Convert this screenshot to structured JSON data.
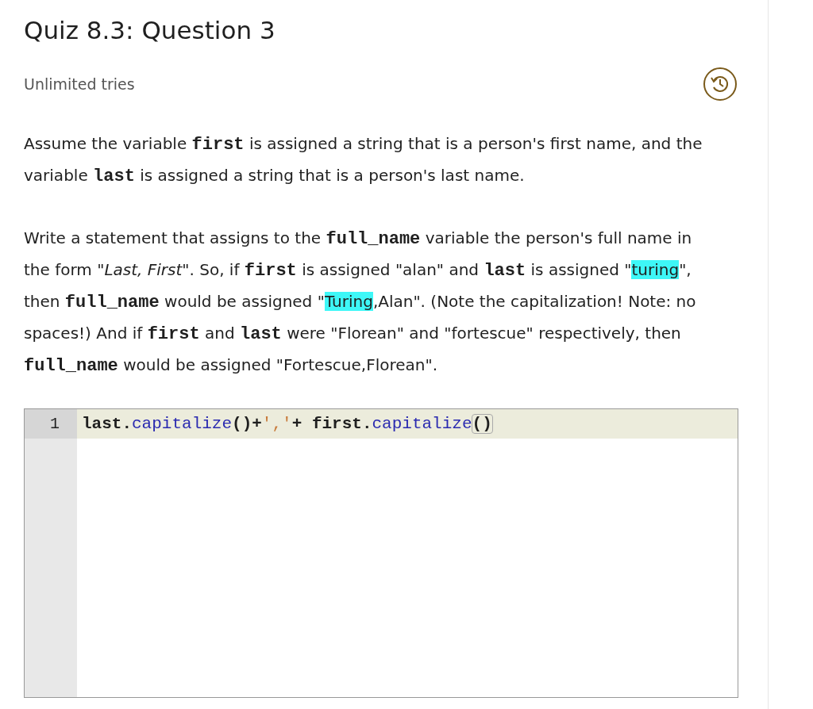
{
  "title": "Quiz 8.3: Question 3",
  "tries": "Unlimited tries",
  "paragraphs": [
    [
      {
        "kind": "text",
        "text": "Assume the variable "
      },
      {
        "kind": "code",
        "text": "first"
      },
      {
        "kind": "text",
        "text": " is assigned a string that is a person's first name, and the variable "
      },
      {
        "kind": "code",
        "text": "last"
      },
      {
        "kind": "text",
        "text": " is assigned a string that is a person's last name."
      }
    ],
    [
      {
        "kind": "text",
        "text": "Write a statement that assigns to the "
      },
      {
        "kind": "code",
        "text": "full_name"
      },
      {
        "kind": "text",
        "text": " variable the person's full name in the form \""
      },
      {
        "kind": "italic",
        "text": "Last, First"
      },
      {
        "kind": "text",
        "text": "\". So, if "
      },
      {
        "kind": "code",
        "text": "first"
      },
      {
        "kind": "text",
        "text": " is assigned \"alan\" and "
      },
      {
        "kind": "code",
        "text": "last"
      },
      {
        "kind": "text",
        "text": " is assigned \""
      },
      {
        "kind": "highlight",
        "text": "turing"
      },
      {
        "kind": "text",
        "text": "\", then "
      },
      {
        "kind": "code",
        "text": "full_name"
      },
      {
        "kind": "text",
        "text": " would be assigned \""
      },
      {
        "kind": "highlight",
        "text": "Turing"
      },
      {
        "kind": "text",
        "text": ",Alan\". (Note the capitalization! Note: no spaces!) And if "
      },
      {
        "kind": "code",
        "text": "first"
      },
      {
        "kind": "text",
        "text": " and "
      },
      {
        "kind": "code",
        "text": "last"
      },
      {
        "kind": "text",
        "text": " were \"Florean\" and \"fortescue\" respectively, then "
      },
      {
        "kind": "code",
        "text": "full_name"
      },
      {
        "kind": "text",
        "text": " would be assigned \"Fortescue,Florean\"."
      }
    ]
  ],
  "editor": {
    "lines": [
      {
        "number": "1",
        "tokens": [
          {
            "kind": "plain",
            "text": "last."
          },
          {
            "kind": "method",
            "text": "capitalize"
          },
          {
            "kind": "plain",
            "text": "()+"
          },
          {
            "kind": "string",
            "text": "','"
          },
          {
            "kind": "plain",
            "text": "+ first."
          },
          {
            "kind": "method",
            "text": "capitalize"
          },
          {
            "kind": "bracket",
            "text": "()"
          }
        ]
      }
    ]
  }
}
